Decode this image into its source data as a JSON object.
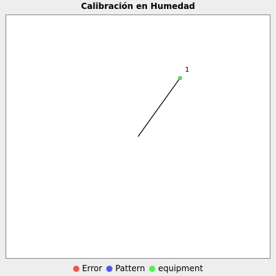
{
  "chart_data": {
    "type": "line",
    "title": "Calibración en Humedad",
    "xlabel": "",
    "ylabel": "",
    "grid": false,
    "legend_position": "bottom",
    "series": [
      {
        "name": "Error",
        "color": "#ee5555",
        "points": []
      },
      {
        "name": "Pattern",
        "color": "#5555ee",
        "points": []
      },
      {
        "name": "equipment",
        "color": "#55ee55",
        "points": [
          {
            "x": 0,
            "y": 0
          },
          {
            "x": 1,
            "y": 1,
            "label": "1"
          }
        ]
      }
    ]
  }
}
